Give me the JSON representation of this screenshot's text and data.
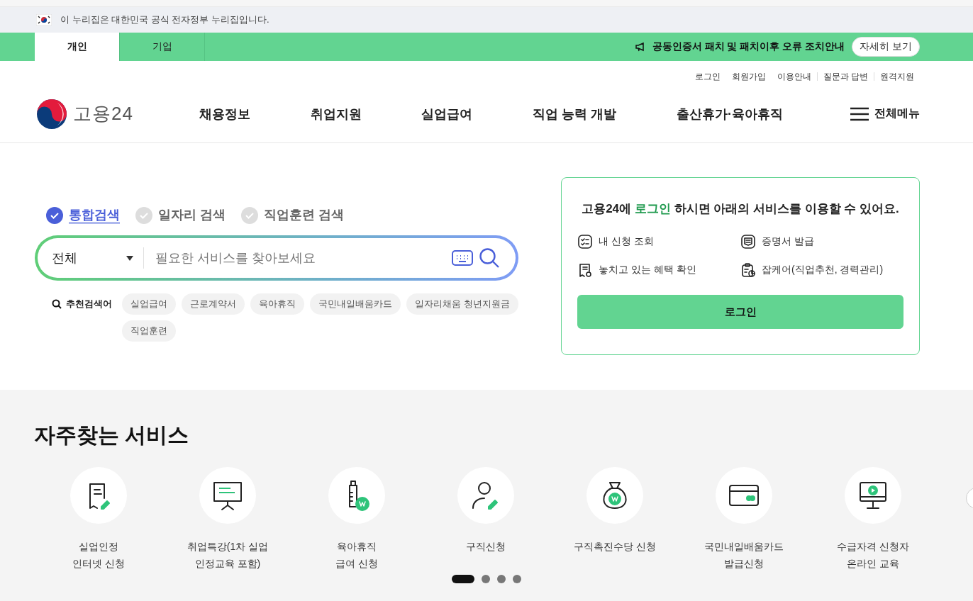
{
  "gov_banner": {
    "text": "이 누리집은 대한민국 공식 전자정부 누리집입니다."
  },
  "audience_tabs": [
    {
      "label": "개인",
      "selected": true
    },
    {
      "label": "기업",
      "selected": false
    }
  ],
  "notice": {
    "text": "공동인증서 패치 및 패치이후 오류 조치안내",
    "button": "자세히 보기"
  },
  "util_links": [
    "로그인",
    "회원가입",
    "이용안내",
    "질문과 답변",
    "원격지원"
  ],
  "logo": {
    "text": "고용24"
  },
  "nav": [
    "채용정보",
    "취업지원",
    "실업급여",
    "직업 능력 개발",
    "출산휴가·육아휴직"
  ],
  "all_menu": "전체메뉴",
  "search": {
    "types": [
      {
        "label": "통합검색",
        "selected": true
      },
      {
        "label": "일자리 검색",
        "selected": false
      },
      {
        "label": "직업훈련 검색",
        "selected": false
      }
    ],
    "scope": "전체",
    "placeholder": "필요한 서비스를 찾아보세요",
    "recommend_label": "추천검색어",
    "keywords": [
      "실업급여",
      "근로계약서",
      "육아휴직",
      "국민내일배움카드",
      "일자리채움 청년지원금",
      "직업훈련"
    ]
  },
  "login_card": {
    "headline_before": "고용24에 ",
    "headline_highlight": "로그인",
    "headline_after": " 하시면 아래의 서비스를 이용할 수 있어요.",
    "features": [
      "내 신청 조회",
      "증명서 발급",
      "놓치고 있는 혜택 확인",
      "잡케어(직업추천, 경력관리)"
    ],
    "button": "로그인"
  },
  "services": {
    "title": "자주찾는 서비스",
    "items": [
      {
        "lines": [
          "실업인정",
          "인터넷 신청"
        ]
      },
      {
        "lines": [
          "취업특강(1차 실업",
          "인정교육 포함)"
        ]
      },
      {
        "lines": [
          "육아휴직",
          "급여 신청"
        ]
      },
      {
        "lines": [
          "구직신청"
        ]
      },
      {
        "lines": [
          "구직촉진수당 신청"
        ]
      },
      {
        "lines": [
          "국민내일배움카드",
          "발급신청"
        ]
      },
      {
        "lines": [
          "수급자격 신청자",
          "온라인 교육"
        ]
      }
    ],
    "pager": [
      {
        "selected": true
      },
      {
        "selected": false
      },
      {
        "selected": false
      },
      {
        "selected": false
      }
    ]
  }
}
